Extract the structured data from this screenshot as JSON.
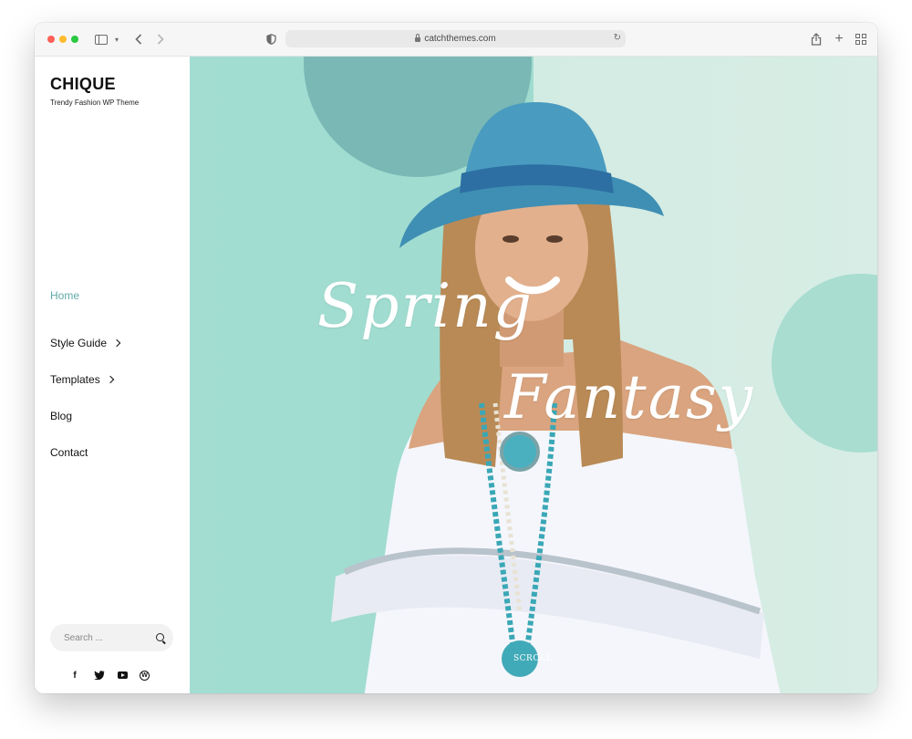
{
  "browser": {
    "url": "catchthemes.com",
    "icons": [
      "sidebar-toggle-icon",
      "chevron-down-icon",
      "back-arrow-icon",
      "forward-arrow-icon",
      "shield-icon",
      "lock-icon",
      "reload-icon",
      "share-icon",
      "plus-icon",
      "tab-overview-icon"
    ]
  },
  "site": {
    "title": "CHIQUE",
    "tagline": "Trendy Fashion WP Theme"
  },
  "nav": {
    "items": [
      {
        "label": "Home",
        "active": true,
        "has_submenu": false
      },
      {
        "label": "Style Guide",
        "active": false,
        "has_submenu": true
      },
      {
        "label": "Templates",
        "active": false,
        "has_submenu": true
      },
      {
        "label": "Blog",
        "active": false,
        "has_submenu": false
      },
      {
        "label": "Contact",
        "active": false,
        "has_submenu": false
      }
    ]
  },
  "search": {
    "placeholder": "Search ..."
  },
  "social": [
    "facebook-icon",
    "twitter-icon",
    "youtube-icon",
    "wordpress-icon"
  ],
  "hero": {
    "title_line1": "Spring",
    "title_line2": "Fantasy",
    "scroll_label": "SCROLL"
  },
  "colors": {
    "accent": "#5fa9a9",
    "hero_left": "#a3ddd2",
    "hero_right": "#d3ece3",
    "circle_dark": "#7ab8b6",
    "circle_light": "#a8ddd0"
  }
}
